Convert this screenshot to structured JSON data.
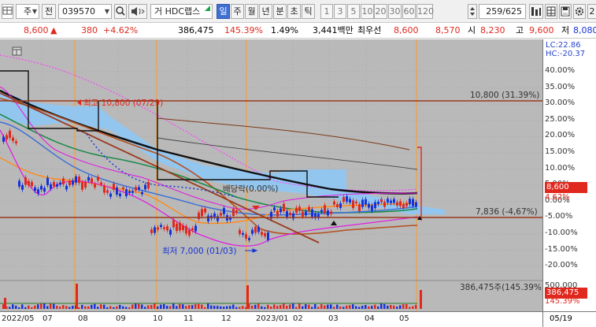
{
  "toolbar": {
    "market_label": "주",
    "prev_label": "전",
    "stock_code": "039570",
    "broker_label": "거",
    "stock_name": "HDC랩스",
    "periods": [
      "일",
      "주",
      "월",
      "년",
      "분",
      "초",
      "틱"
    ],
    "period_selected": "일",
    "intervals": [
      "1",
      "3",
      "5",
      "10",
      "20",
      "30",
      "60",
      "120"
    ],
    "count_display": "259/625",
    "trailing_digit": "2"
  },
  "quote": {
    "price": "8,600",
    "change_arrow": "▲",
    "change": "380",
    "change_pct": "+4.62%",
    "volume": "386,475",
    "volume_ratio": "145.39%",
    "turnover_rate": "1.49%",
    "amount": "3,441백만",
    "best_ask_label": "최우선",
    "best_ask": "8,600",
    "best_bid": "8,570",
    "open_label": "시",
    "open": "8,230",
    "high_label": "고",
    "high": "9,600",
    "low_label": "저",
    "low": "8,080"
  },
  "chart": {
    "lc_label": "LC:22.86",
    "hc_label": "HC:-20.37",
    "y_ticks": [
      "40.00%",
      "35.00%",
      "30.00%",
      "25.00%",
      "20.00%",
      "15.00%",
      "10.00%",
      "5.00%",
      "0.00%",
      "-5.00%",
      "-10.00%",
      "-15.00%",
      "-20.00%"
    ],
    "price_tag": "8,600",
    "price_tag_pct": "4.62%",
    "high_marker": "최고 10,800 (07/29)",
    "low_marker": "최저 7,000 (01/03)",
    "dividend_label": "배당락(0.00%)",
    "hline_top_label": "10,800 (31.39%)",
    "hline_bottom_label": "7,836 (-4,67%)",
    "volume_label": "386,475주(145.39%)",
    "volume_tick": "500,000",
    "volume_tag": "386,475",
    "volume_tag_pct": "145.39%",
    "x_ticks": [
      "2022/05",
      "07",
      "08",
      "09",
      "10",
      "11",
      "12",
      "2023/01",
      "02",
      "03",
      "04",
      "05"
    ],
    "date_label": "05/19"
  },
  "colors": {
    "up": "#e0281e",
    "down": "#1532d8",
    "selected": "#3f6fd1",
    "chart_bg": "#b9b9b9"
  }
}
